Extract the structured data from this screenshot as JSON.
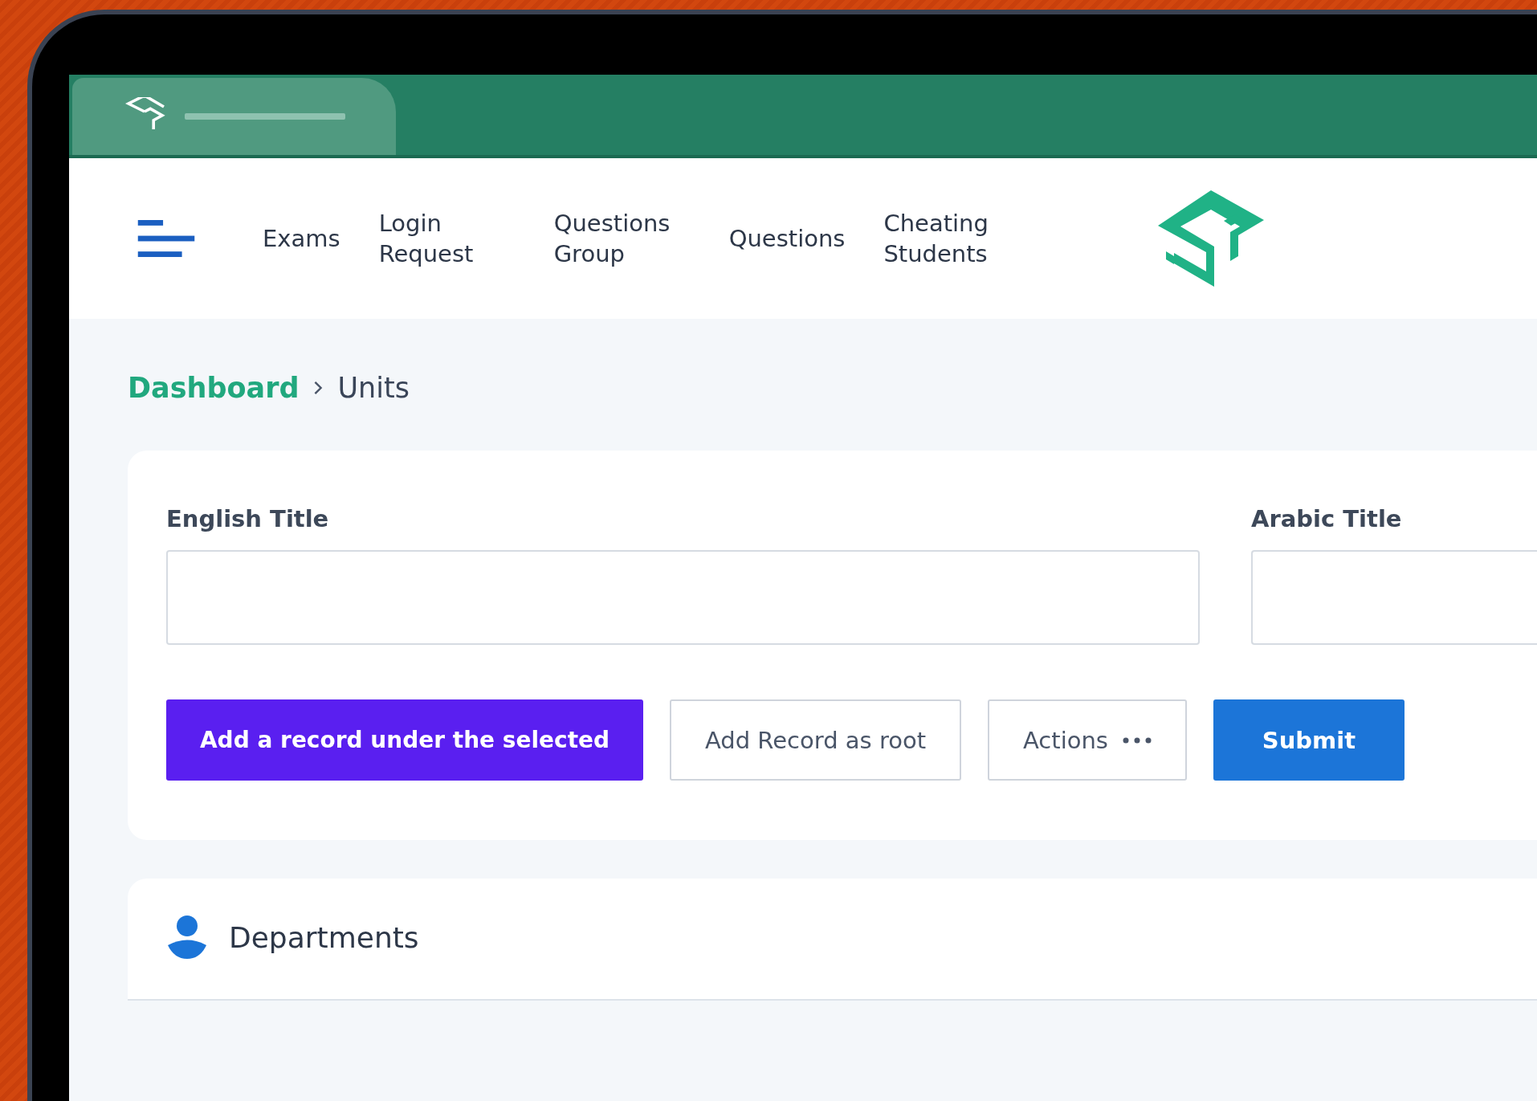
{
  "nav": {
    "items": [
      {
        "label": "Exams"
      },
      {
        "label": "Login Request"
      },
      {
        "label": "Questions Group"
      },
      {
        "label": "Questions"
      },
      {
        "label": "Cheating Students"
      }
    ]
  },
  "breadcrumb": [
    {
      "label": "Dashboard",
      "kind": "link"
    },
    {
      "label": "Units",
      "kind": "current"
    }
  ],
  "form": {
    "fields": [
      {
        "label": "English Title"
      },
      {
        "label": "Arabic Title"
      }
    ],
    "buttons": [
      {
        "label": "Add a record under the selected",
        "kind": "primary"
      },
      {
        "label": "Add Record as root",
        "kind": "outline"
      },
      {
        "label": "Actions",
        "kind": "menu"
      },
      {
        "label": "Submit",
        "kind": "submit"
      }
    ]
  },
  "section": {
    "title": "Departments"
  }
}
